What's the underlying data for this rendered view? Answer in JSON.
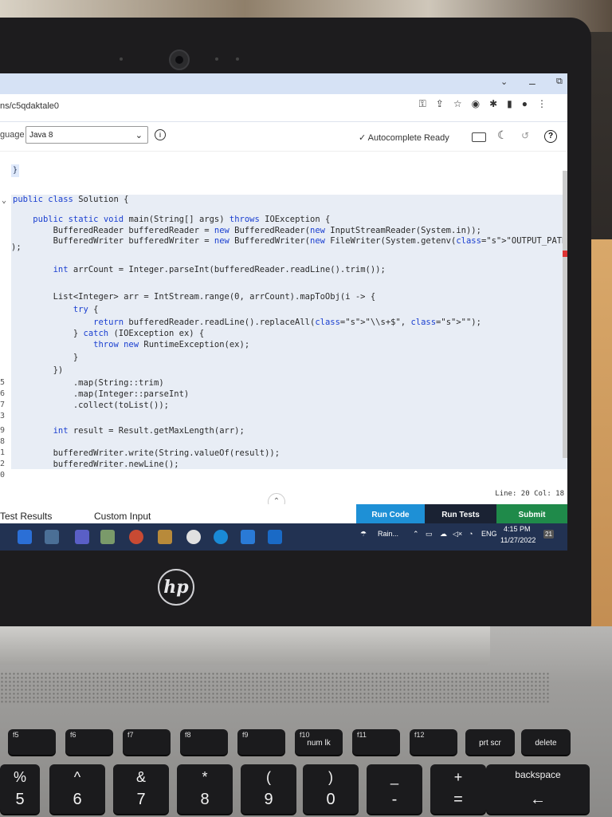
{
  "browser": {
    "tab_fragment": "ns/c5qdaktale0",
    "window_controls": [
      "chevron-down-icon",
      "minimize-icon",
      "restore-icon",
      "close-icon"
    ]
  },
  "toolbar": {
    "language_label": "guage",
    "language_value": "Java 8",
    "autocomplete_status": "Autocomplete Ready"
  },
  "editor": {
    "first_line_bracket": "}",
    "lines": [
      {
        "ln": "",
        "text": "public class Solution {"
      },
      {
        "ln": "",
        "text": "    public static void main(String[] args) throws IOException {"
      },
      {
        "ln": "",
        "text": "        BufferedReader bufferedReader = new BufferedReader(new InputStreamReader(System.in));"
      },
      {
        "ln": "",
        "text": "        BufferedWriter bufferedWriter = new BufferedWriter(new FileWriter(System.getenv(\"OUTPUT_PATH\"))"
      },
      {
        "ln": "",
        "text": ");"
      },
      {
        "ln": "",
        "text": "        int arrCount = Integer.parseInt(bufferedReader.readLine().trim());"
      },
      {
        "ln": "",
        "text": "        List<Integer> arr = IntStream.range(0, arrCount).mapToObj(i -> {"
      },
      {
        "ln": "",
        "text": "            try {"
      },
      {
        "ln": "",
        "text": "                return bufferedReader.readLine().replaceAll(\"\\\\s+$\", \"\");"
      },
      {
        "ln": "",
        "text": "            } catch (IOException ex) {"
      },
      {
        "ln": "",
        "text": "                throw new RuntimeException(ex);"
      },
      {
        "ln": "",
        "text": "            }"
      },
      {
        "ln": "",
        "text": "        })"
      },
      {
        "ln": "5",
        "text": "            .map(String::trim)"
      },
      {
        "ln": "6",
        "text": "            .map(Integer::parseInt)"
      },
      {
        "ln": "7",
        "text": "            .collect(toList());"
      },
      {
        "ln": "9",
        "text": "        int result = Result.getMaxLength(arr);"
      },
      {
        "ln": "1",
        "text": "        bufferedWriter.write(String.valueOf(result));"
      },
      {
        "ln": "2",
        "text": "        bufferedWriter.newLine();"
      }
    ],
    "gutter_extra": [
      "3",
      "8",
      "0"
    ],
    "status": "Line: 20 Col: 18"
  },
  "bottom": {
    "tab_test_results": "Test Results",
    "tab_custom_input": "Custom Input",
    "run_code": "Run Code",
    "run_tests": "Run Tests",
    "submit": "Submit"
  },
  "taskbar": {
    "weather": "Rain...",
    "lang": "ENG",
    "time": "4:15 PM",
    "date": "11/27/2022",
    "notifications": "21"
  },
  "keyboard": {
    "fn_row": [
      {
        "fn": "f5",
        "label": ""
      },
      {
        "fn": "f6",
        "label": ""
      },
      {
        "fn": "f7",
        "label": ""
      },
      {
        "fn": "f8",
        "label": ""
      },
      {
        "fn": "f9",
        "label": ""
      },
      {
        "fn": "f10",
        "label": "num lk"
      },
      {
        "fn": "f11",
        "label": ""
      },
      {
        "fn": "f12",
        "label": ""
      },
      {
        "fn": "",
        "label": "prt scr"
      },
      {
        "fn": "",
        "label": "delete"
      }
    ],
    "num_row": [
      {
        "top": "%",
        "bottom": "5"
      },
      {
        "top": "^",
        "bottom": "6"
      },
      {
        "top": "&",
        "bottom": "7"
      },
      {
        "top": "*",
        "bottom": "8"
      },
      {
        "top": "(",
        "bottom": "9"
      },
      {
        "top": ")",
        "bottom": "0"
      },
      {
        "top": "_",
        "bottom": "-"
      },
      {
        "top": "+",
        "bottom": "="
      },
      {
        "top": "backspace",
        "bottom": "←"
      }
    ]
  },
  "brand": "hp",
  "colors": {
    "run_code": "#1e90d6",
    "run_tests": "#1a2233",
    "submit": "#1f8a4a",
    "keyword": "#1a3fd0",
    "string": "#a33"
  }
}
